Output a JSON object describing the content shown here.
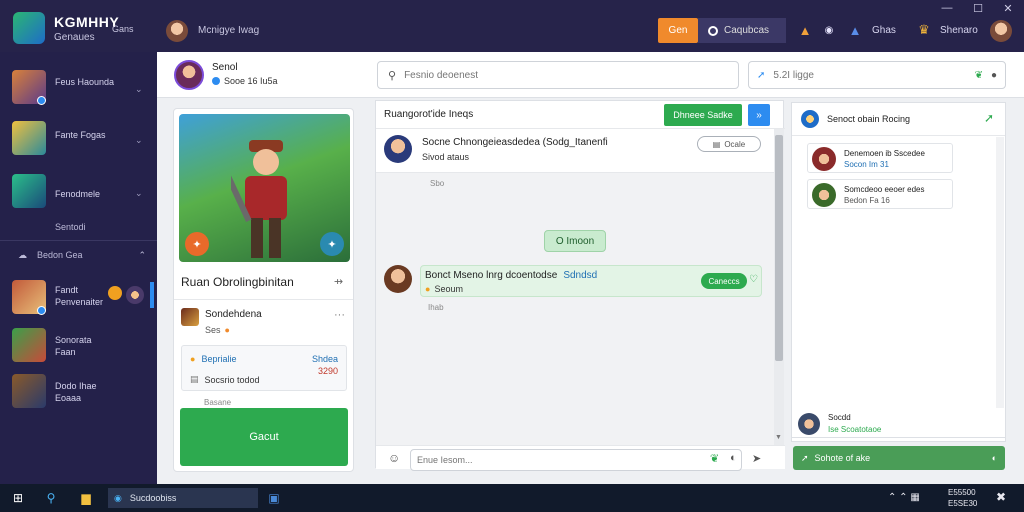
{
  "brand": {
    "name": "KGMHHY",
    "sub": "Genaues",
    "tag": "Gans"
  },
  "titlebar": {
    "user_name": "Mcnigye Iwag",
    "orange_btn": "Gen",
    "dark_btn": "Caqubcas",
    "link1": "Ghas",
    "link2": "Shenaro",
    "win_min": "—",
    "win_max": "☐",
    "win_close": "✕"
  },
  "sidebar": {
    "items": [
      {
        "label": "Feus Haounda"
      },
      {
        "label": "Fante Fogas"
      },
      {
        "label": "Fenodmele"
      }
    ],
    "section1": "Sentodi",
    "section2": "Bedon Gea",
    "games": [
      {
        "label": "Fandt Penvenaiter"
      },
      {
        "label": "Sonorata Faan"
      },
      {
        "label": "Dodo Ihae Eoaaa"
      }
    ]
  },
  "topbar": {
    "profile_name": "Senol",
    "profile_status": "Sooe 16 Iu5a",
    "search_placeholder": "Fesnio deoenest",
    "input2_placeholder": "5.2I ligge"
  },
  "profile": {
    "title": "Ruan Obrolingbinitan",
    "game_name": "Sondehdena",
    "game_sub": "Ses",
    "info": [
      {
        "label": "Beprialie",
        "value": "Shdea"
      },
      {
        "label": "Socsrio todod",
        "value": "3290"
      }
    ],
    "footer": "Basane",
    "cta_label": "Gacut"
  },
  "chat": {
    "title": "Ruangorot'ide Ineqs",
    "green_btn": "Dhneee Sadke",
    "blue_btn": "»",
    "top_msg_name": "Socne Chnongeieasdedea (Sodg_Itanenfi",
    "top_msg_sub": "Sivod ataus",
    "top_msg_pill": "Ocale",
    "ts1": "Sbo",
    "center_pill": "O Imoon",
    "bubble_name": "Bonct Mseno lnrg dcoentodse",
    "bubble_highlight": "Sdndsd",
    "bubble_sub": "Seoum",
    "bubble_pill": "Caneccs",
    "ts2": "Ihab",
    "input_placeholder": "Enue Iesom..."
  },
  "right": {
    "title": "Senoct obain Rocing",
    "cards": [
      {
        "name": "Denemoen ib Sscedee",
        "sub": "Socon Im 31"
      },
      {
        "name": "Somcdeoo eeoer edes",
        "sub": "Bedon Fa 16"
      }
    ],
    "foot_name": "Socdd",
    "foot_sub": "Ise Scoatotaoe",
    "cta_label": "Sohote of ake"
  },
  "taskbar": {
    "app_label": "Sucdoobiss",
    "time": "E55500",
    "date": "E5SE30"
  }
}
